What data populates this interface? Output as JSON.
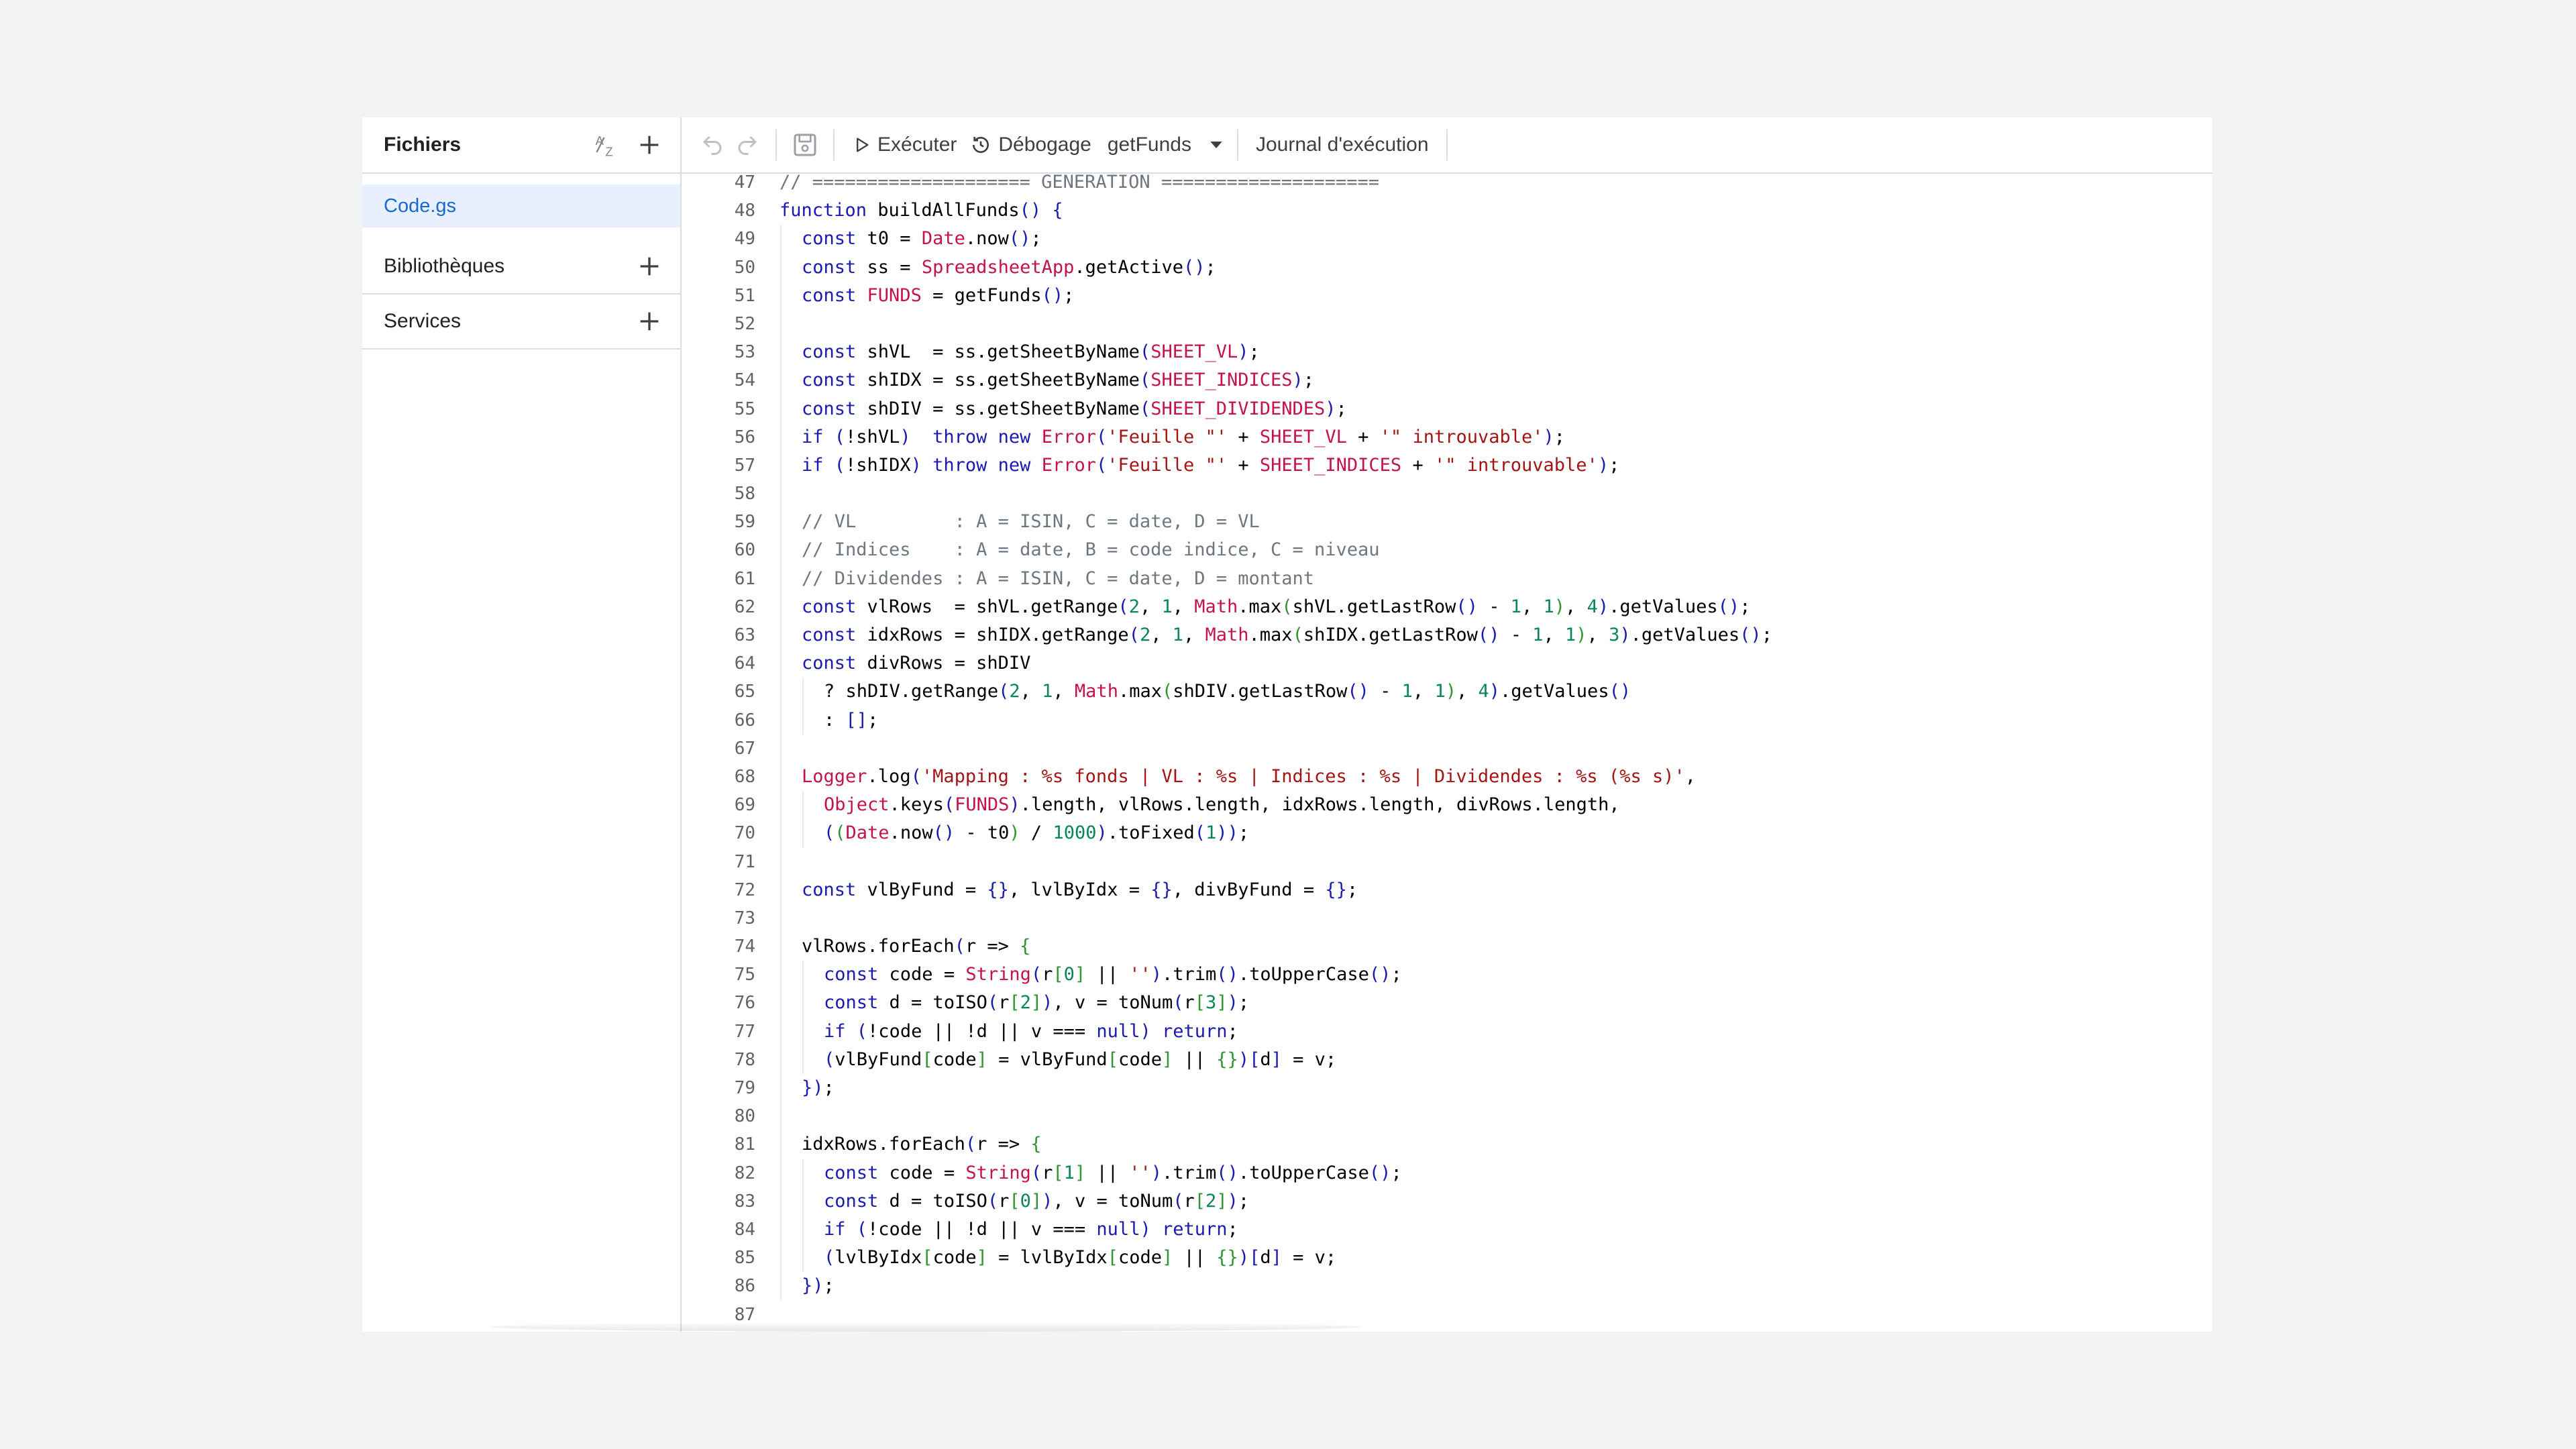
{
  "sidebar": {
    "files_title": "Fichiers",
    "sort_icon": "sort-az-icon",
    "add_icon": "plus-icon",
    "file_item": "Code.gs",
    "libraries_title": "Bibliothèques",
    "services_title": "Services"
  },
  "toolbar": {
    "undo_icon": "undo-icon",
    "redo_icon": "redo-icon",
    "save_icon": "save-icon",
    "run_label": "Exécuter",
    "debug_label": "Débogage",
    "function_select": "getFunds",
    "log_label": "Journal d'exécution"
  },
  "colors": {
    "keyword": "#1a1ab0",
    "class": "#c4124e",
    "string": "#a31515",
    "number": "#098658",
    "comment": "#6e7781",
    "selected_file_bg": "#e8f0fe",
    "selected_file_text": "#1967d2"
  },
  "editor": {
    "lines": [
      {
        "n": "47",
        "indent": 0,
        "text": "// ==================== GENERATION ===================="
      },
      {
        "n": "48",
        "indent": 0,
        "text": "function buildAllFunds() {"
      },
      {
        "n": "49",
        "indent": 1,
        "text": "const t0 = Date.now();"
      },
      {
        "n": "50",
        "indent": 1,
        "text": "const ss = SpreadsheetApp.getActive();"
      },
      {
        "n": "51",
        "indent": 1,
        "text": "const FUNDS = getFunds();"
      },
      {
        "n": "52",
        "indent": 0,
        "text": ""
      },
      {
        "n": "53",
        "indent": 1,
        "text": "const shVL  = ss.getSheetByName(SHEET_VL);"
      },
      {
        "n": "54",
        "indent": 1,
        "text": "const shIDX = ss.getSheetByName(SHEET_INDICES);"
      },
      {
        "n": "55",
        "indent": 1,
        "text": "const shDIV = ss.getSheetByName(SHEET_DIVIDENDES);"
      },
      {
        "n": "56",
        "indent": 1,
        "text": "if (!shVL)  throw new Error('Feuille \"' + SHEET_VL + '\" introuvable');"
      },
      {
        "n": "57",
        "indent": 1,
        "text": "if (!shIDX) throw new Error('Feuille \"' + SHEET_INDICES + '\" introuvable');"
      },
      {
        "n": "58",
        "indent": 0,
        "text": ""
      },
      {
        "n": "59",
        "indent": 1,
        "text": "// VL         : A = ISIN, C = date, D = VL"
      },
      {
        "n": "60",
        "indent": 1,
        "text": "// Indices    : A = date, B = code indice, C = niveau"
      },
      {
        "n": "61",
        "indent": 1,
        "text": "// Dividendes : A = ISIN, C = date, D = montant"
      },
      {
        "n": "62",
        "indent": 1,
        "text": "const vlRows  = shVL.getRange(2, 1, Math.max(shVL.getLastRow() - 1, 1), 4).getValues();"
      },
      {
        "n": "63",
        "indent": 1,
        "text": "const idxRows = shIDX.getRange(2, 1, Math.max(shIDX.getLastRow() - 1, 1), 3).getValues();"
      },
      {
        "n": "64",
        "indent": 1,
        "text": "const divRows = shDIV"
      },
      {
        "n": "65",
        "indent": 2,
        "text": "? shDIV.getRange(2, 1, Math.max(shDIV.getLastRow() - 1, 1), 4).getValues()"
      },
      {
        "n": "66",
        "indent": 2,
        "text": ": [];"
      },
      {
        "n": "67",
        "indent": 1,
        "text": ""
      },
      {
        "n": "68",
        "indent": 1,
        "text": "Logger.log('Mapping : %s fonds | VL : %s | Indices : %s | Dividendes : %s (%s s)',"
      },
      {
        "n": "69",
        "indent": 2,
        "text": "Object.keys(FUNDS).length, vlRows.length, idxRows.length, divRows.length,"
      },
      {
        "n": "70",
        "indent": 2,
        "text": "((Date.now() - t0) / 1000).toFixed(1));"
      },
      {
        "n": "71",
        "indent": 1,
        "text": ""
      },
      {
        "n": "72",
        "indent": 1,
        "text": "const vlByFund = {}, lvlByIdx = {}, divByFund = {};"
      },
      {
        "n": "73",
        "indent": 0,
        "text": ""
      },
      {
        "n": "74",
        "indent": 1,
        "text": "vlRows.forEach(r => {"
      },
      {
        "n": "75",
        "indent": 2,
        "text": "const code = String(r[0] || '').trim().toUpperCase();"
      },
      {
        "n": "76",
        "indent": 2,
        "text": "const d = toISO(r[2]), v = toNum(r[3]);"
      },
      {
        "n": "77",
        "indent": 2,
        "text": "if (!code || !d || v === null) return;"
      },
      {
        "n": "78",
        "indent": 2,
        "text": "(vlByFund[code] = vlByFund[code] || {})[d] = v;"
      },
      {
        "n": "79",
        "indent": 1,
        "text": "});"
      },
      {
        "n": "80",
        "indent": 0,
        "text": ""
      },
      {
        "n": "81",
        "indent": 1,
        "text": "idxRows.forEach(r => {"
      },
      {
        "n": "82",
        "indent": 2,
        "text": "const code = String(r[1] || '').trim().toUpperCase();"
      },
      {
        "n": "83",
        "indent": 2,
        "text": "const d = toISO(r[0]), v = toNum(r[2]);"
      },
      {
        "n": "84",
        "indent": 2,
        "text": "if (!code || !d || v === null) return;"
      },
      {
        "n": "85",
        "indent": 2,
        "text": "(lvlByIdx[code] = lvlByIdx[code] || {})[d] = v;"
      },
      {
        "n": "86",
        "indent": 1,
        "text": "});"
      },
      {
        "n": "87",
        "indent": 0,
        "text": ""
      }
    ]
  }
}
